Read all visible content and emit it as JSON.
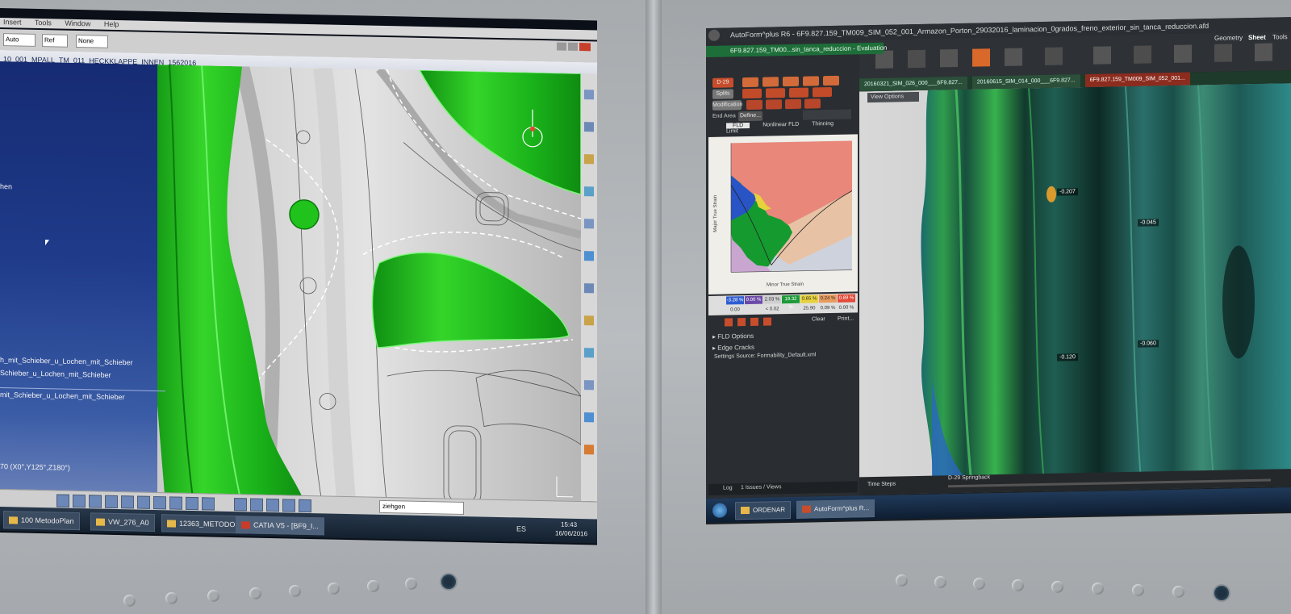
{
  "left_screen": {
    "menu": [
      "Insert",
      "Tools",
      "Window",
      "Help"
    ],
    "toolbar_fields": [
      "Auto",
      "Ref",
      "None"
    ],
    "doc_title": "10_001_MPALL_TM_011_HECKKLAPPE_INNEN_1562016",
    "tree_items": [
      "hen",
      "h_mit_Schieber_u_Lochen_mit_Schieber",
      "Schieber_u_Lochen_mit_Schieber",
      "mit_Schieber_u_Lochen_mit_Schieber",
      "70 (X0°,Y125°,Z180°)"
    ],
    "bottom_field": "ziehgen",
    "clock_time": "15:43",
    "clock_date": "16/06/2016",
    "taskbar_lang": "ES",
    "taskbar_items": [
      "100 MetodoPlan",
      "VW_276_A0",
      "12363_METODOP...",
      "CATIA V5 - [BF9_I..."
    ],
    "colors": {
      "surface_green": "#22c21e",
      "tree_blue": "#1f3b8a"
    }
  },
  "right_screen": {
    "window_title": "AutoForm^plus R6 - 6F9.827.159_TM009_SIM_052_001_Armazon_Porton_29032016_laminacion_0grados_freno_exterior_sin_tanca_reduccion.afd",
    "ribbon_tabs": [
      "Geometry",
      "Sheet",
      "Tools"
    ],
    "panel_title": "6F9.827.159_TM00...sin_tanca_reduccion - Evaluation",
    "panel_buttons": [
      "D-29",
      "Splits",
      "Modification",
      "End Area",
      "Define..."
    ],
    "fld_tabs": [
      "FLD",
      "Nonlinear FLD",
      "Thinning Limit"
    ],
    "fld_xlabel": "Minor True Strain",
    "fld_ylabel": "Major True Strain",
    "legend_values": [
      "-3.28 %",
      "0.00 %",
      "2.03 %",
      "19.32 %",
      "0.65 %",
      "0.24 %",
      "0.89 %"
    ],
    "legend_row2": [
      "0.00",
      "< 0.02",
      "25.90 %",
      "0.09 %",
      "0.00 %"
    ],
    "legend_actions": [
      "Clear",
      "Print..."
    ],
    "panel_sections": [
      "FLD Options",
      "Edge Cracks"
    ],
    "settings_source": "Settings Source:  Formability_Default.xml",
    "doc_tabs": [
      "20160321_SIM_026_000___6F9.827...",
      "20160615_SIM_014_000___6F9.827...",
      "6F9.827.159_TM009_SIM_052_001..."
    ],
    "path_line": "6F9.827.159_TM009_SIM_052_001_Armazon_Porton_29032016_laminacion_0grados_freno_exterior_sin_tanca_reduccion",
    "view_options": "View Options",
    "value_labels": [
      "-0.207",
      "-0.045",
      "-0.120",
      "-0.060"
    ],
    "time_steps": "Time Steps",
    "step_label": "D-29 Springback",
    "log_tabs": [
      "Log",
      "1 Issues / Views"
    ],
    "taskbar_items": [
      "ORDENAR",
      "AutoForm^plus R..."
    ],
    "colors": {
      "ui_bg": "#2a2d31",
      "accent_red": "#c74d2c",
      "fld_safe": "#1d9a3a",
      "fld_crack": "#e88a7c"
    }
  },
  "bezel": {
    "left_buttons": 9,
    "right_buttons": 9
  }
}
